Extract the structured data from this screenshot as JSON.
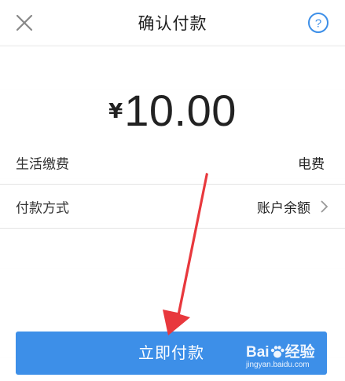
{
  "header": {
    "title": "确认付款",
    "close_icon": "close-icon",
    "help_icon": "help-icon",
    "help_symbol": "?"
  },
  "amount": {
    "currency_symbol": "¥",
    "value": "10.00"
  },
  "rows": [
    {
      "label": "生活缴费",
      "value": "电费",
      "has_chevron": false
    },
    {
      "label": "付款方式",
      "value": "账户余额",
      "has_chevron": true
    }
  ],
  "pay_button": {
    "label": "立即付款"
  },
  "annotation": {
    "type": "red-arrow",
    "color": "#e8383d"
  },
  "watermark": {
    "text_left": "Bai",
    "text_right": "经验",
    "url": "jingyan.baidu.com"
  },
  "colors": {
    "accent": "#3d8fe8",
    "text": "#222222",
    "divider": "#e4e4e4"
  }
}
